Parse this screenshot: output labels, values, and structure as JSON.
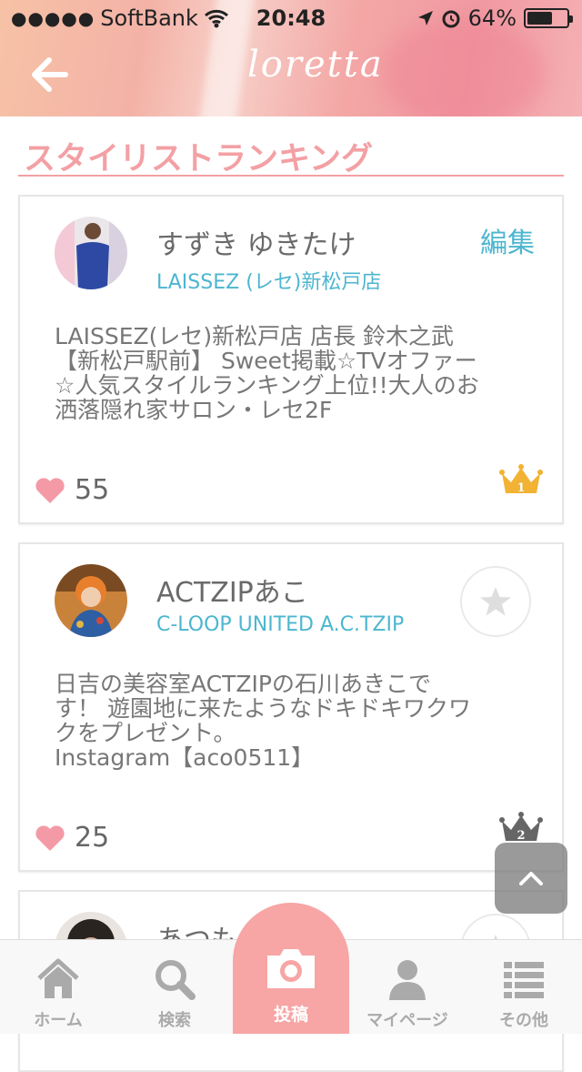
{
  "status_bar": {
    "signal_dots": "●●●●●",
    "carrier": "SoftBank",
    "time": "20:48",
    "battery_text": "64%",
    "battery_level": 0.64
  },
  "header": {
    "logo_text": "loretta"
  },
  "page_title": "スタイリストランキング",
  "stylists": [
    {
      "name": "すずき ゆきたけ",
      "salon": "LAISSEZ (レセ)新松戸店",
      "action_label": "編集",
      "description": "LAISSEZ(レセ)新松戸店 店長 鈴木之武\n【新松戸駅前】 Sweet掲載☆TVオファー\n☆人気スタイルランキング上位!!大人のお\n洒落隠れ家サロン・レセ2F",
      "likes": "55",
      "rank": "1",
      "crown_color": "#f2b233"
    },
    {
      "name": "ACTZIPあこ",
      "salon": "C-LOOP UNITED A.C.TZIP",
      "description": "日吉の美容室ACTZIPの石川あきこで\nす！ 遊園地に来たようなドキドキワクワ\nクをプレゼント。\nInstagram【aco0511】",
      "likes": "25",
      "rank": "2",
      "crown_color": "#666666"
    },
    {
      "name": "あつも"
    }
  ],
  "tabs": [
    {
      "label": "ホーム",
      "icon": "home-icon"
    },
    {
      "label": "検索",
      "icon": "search-icon"
    },
    {
      "label": "投稿",
      "icon": "camera-icon"
    },
    {
      "label": "マイページ",
      "icon": "person-icon"
    },
    {
      "label": "その他",
      "icon": "list-icon"
    }
  ],
  "colors": {
    "accent_pink": "#f3a0a4",
    "link_blue": "#4db6cf",
    "heart": "#f49aa6",
    "crown_gold": "#f2b233"
  }
}
